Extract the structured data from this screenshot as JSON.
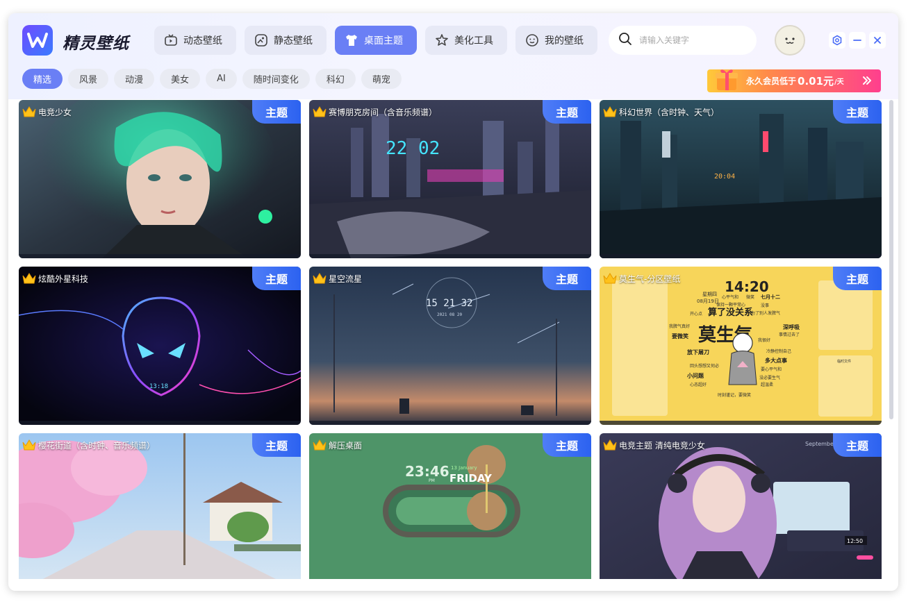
{
  "app": {
    "title": "精灵壁纸"
  },
  "nav": [
    {
      "label": "动态壁纸",
      "icon": "tv-icon",
      "active": false
    },
    {
      "label": "静态壁纸",
      "icon": "image-icon",
      "active": false
    },
    {
      "label": "桌面主题",
      "icon": "shirt-icon",
      "active": true
    },
    {
      "label": "美化工具",
      "icon": "magic-icon",
      "active": false
    },
    {
      "label": "我的壁纸",
      "icon": "smile-icon",
      "active": false
    }
  ],
  "search": {
    "placeholder": "请输入关键字"
  },
  "tags": [
    "精选",
    "风景",
    "动漫",
    "美女",
    "AI",
    "随时间变化",
    "科幻",
    "萌宠"
  ],
  "active_tag": "精选",
  "vip": {
    "text": "永久会员低于",
    "price": "0.01元",
    "unit": "/天"
  },
  "badge_label": "主题",
  "cards": [
    {
      "title": "电竞少女"
    },
    {
      "title": "赛博朋克房间（含音乐频谱）"
    },
    {
      "title": "科幻世界（含时钟、天气）"
    },
    {
      "title": "炫酷外星科技"
    },
    {
      "title": "星空流星"
    },
    {
      "title": "莫生气-分区壁纸"
    },
    {
      "title": "樱花街道（含时钟、音乐频谱）"
    },
    {
      "title": "解压桌面"
    },
    {
      "title": "电竞主题 清纯电竞少女"
    }
  ],
  "thumb_text": {
    "clock_cyber": "22 02",
    "clock_scifi": "20:04",
    "clock_alien": "13:18",
    "clock_stars": "15 21 32",
    "date_stars": "2021 08 20",
    "mood_time": "14:20",
    "mood_big": "莫生气",
    "mood_small": "算了没关系",
    "mood_lines": [
      "星期四",
      "08月19日",
      "心平气和",
      "微笑",
      "七月十二",
      "保持一颗平常心",
      "没事",
      "开心点",
      "为了别人发脾气",
      "我脾气真好",
      "要微笑",
      "深呼吸",
      "事情过去了",
      "我很好",
      "放下屠刀",
      "冷静控制自己",
      "回头想想又何必",
      "多大点事",
      "要心平气和",
      "小问题",
      "没必要生气",
      "心态超好",
      "超温柔",
      "时刻谨记，要微笑"
    ],
    "mood_note": "临时文件",
    "relax_time": "23:46",
    "relax_pm": "PM",
    "relax_date": "13 January",
    "relax_day": "FRIDAY",
    "esport_month": "September",
    "esport_clock": "12:50"
  },
  "colors": {
    "accent": "#6a7ff5",
    "badge": "#2c62f0"
  }
}
